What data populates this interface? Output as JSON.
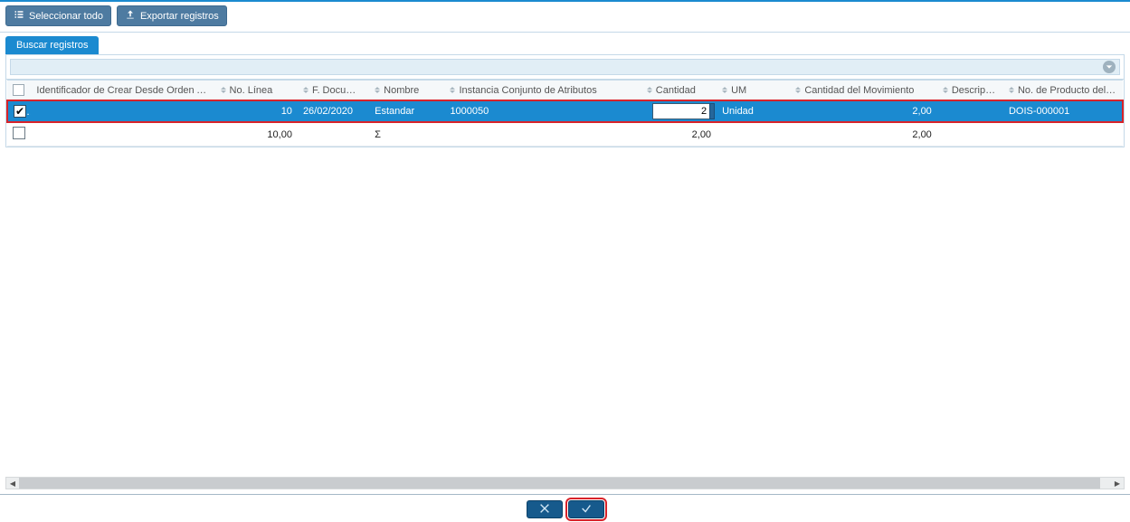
{
  "toolbar": {
    "select_all_label": "Seleccionar todo",
    "export_label": "Exportar registros"
  },
  "search": {
    "tab_label": "Buscar registros"
  },
  "columns": {
    "id": "Identificador de Crear Desde Orden ADM",
    "line": "No. Línea",
    "fdoc": "F. Documento",
    "name": "Nombre",
    "inst": "Instancia Conjunto de Atributos",
    "qty": "Cantidad",
    "um": "UM",
    "mov": "Cantidad del Movimiento",
    "desc": "Descripción",
    "prod": "No. de Producto del Socio del"
  },
  "row": {
    "checked": true,
    "id": "",
    "line": "10",
    "fdoc": "26/02/2020",
    "name": "Estandar",
    "inst": "1000050",
    "qty": "2",
    "um": "Unidad",
    "mov": "2,00",
    "desc": "",
    "prod": "DOIS-000001"
  },
  "totals": {
    "line": "10,00",
    "sigma": "Σ",
    "qty": "2,00",
    "mov": "2,00"
  },
  "icons": {
    "select_all": "list-icon",
    "export": "upload-icon",
    "collapse": "chevron-down-icon",
    "cancel": "x-icon",
    "confirm": "check-icon"
  }
}
